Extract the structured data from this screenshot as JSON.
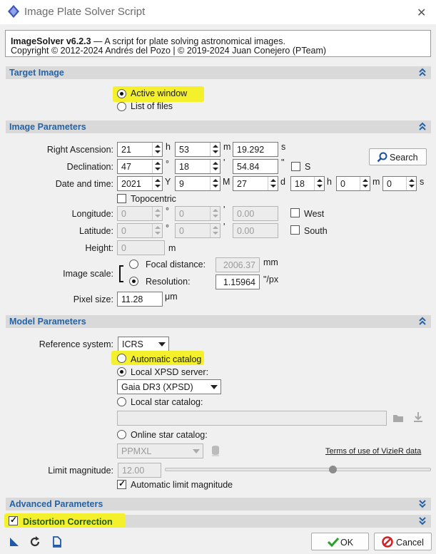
{
  "window": {
    "title": "Image Plate Solver Script",
    "close": "✕"
  },
  "info": {
    "line1_bold": "ImageSolver v6.2.3",
    "line1_rest": " — A script for plate solving astronomical images.",
    "line2": "Copyright © 2012-2024 Andrés del Pozo | © 2019-2024 Juan Conejero (PTeam)"
  },
  "sections": {
    "target": "Target Image",
    "image_params": "Image Parameters",
    "model_params": "Model Parameters",
    "advanced": "Advanced Parameters",
    "distortion": "Distortion Correction"
  },
  "target": {
    "active_window": "Active window",
    "list_of_files": "List of files",
    "selected": "active_window"
  },
  "ra": {
    "label": "Right Ascension:",
    "h": "21",
    "h_unit": "h",
    "m": "53",
    "m_unit": "m",
    "s": "19.292",
    "s_unit": "s"
  },
  "dec": {
    "label": "Declination:",
    "d": "47",
    "d_unit": "°",
    "m": "18",
    "m_unit": "'",
    "s": "54.84",
    "s_unit": "\"",
    "south_label": "S",
    "south_checked": false
  },
  "search_label": "Search",
  "datetime": {
    "label": "Date and time:",
    "Y": "2021",
    "Y_unit": "Y",
    "M": "9",
    "M_unit": "M",
    "d": "27",
    "d_unit": "d",
    "h": "18",
    "h_unit": "h",
    "m": "0",
    "m_unit": "m",
    "s": "0",
    "s_unit": "s"
  },
  "topocentric": {
    "label": "Topocentric",
    "checked": false
  },
  "longitude": {
    "label": "Longitude:",
    "d": "0",
    "d_unit": "°",
    "m": "0",
    "m_unit": "'",
    "s": "0.00",
    "check_label": "West"
  },
  "latitude": {
    "label": "Latitude:",
    "d": "0",
    "d_unit": "°",
    "m": "0",
    "m_unit": "'",
    "s": "0.00",
    "check_label": "South"
  },
  "height": {
    "label": "Height:",
    "value": "0",
    "unit": "m"
  },
  "image_scale": {
    "label": "Image scale:",
    "focal_label": "Focal distance:",
    "focal_value": "2006.37",
    "focal_unit": "mm",
    "res_label": "Resolution:",
    "res_value": "1.15964",
    "res_unit": "\"/px",
    "selected": "resolution"
  },
  "pixel_size": {
    "label": "Pixel size:",
    "value": "11.28",
    "unit": "μm"
  },
  "model": {
    "ref_label": "Reference system:",
    "ref_value": "ICRS",
    "auto_catalog": "Automatic catalog",
    "local_xpsd": "Local XPSD server:",
    "xpsd_value": "Gaia DR3 (XPSD)",
    "local_star": "Local star catalog:",
    "local_star_path": "",
    "online_star": "Online star catalog:",
    "online_value": "PPMXL",
    "terms_link": "Terms of use of VizieR data",
    "limit_label": "Limit magnitude:",
    "limit_value": "12.00",
    "limit_slider": 0.63,
    "auto_limit": "Automatic limit magnitude",
    "auto_limit_checked": true,
    "selected": "local_xpsd"
  },
  "distortion_checked": true,
  "footer": {
    "ok": "OK",
    "cancel": "Cancel"
  },
  "colors": {
    "section_text": "#2363a8",
    "highlight": "#f5f02c",
    "distortion_text": "#1d5a1d"
  }
}
